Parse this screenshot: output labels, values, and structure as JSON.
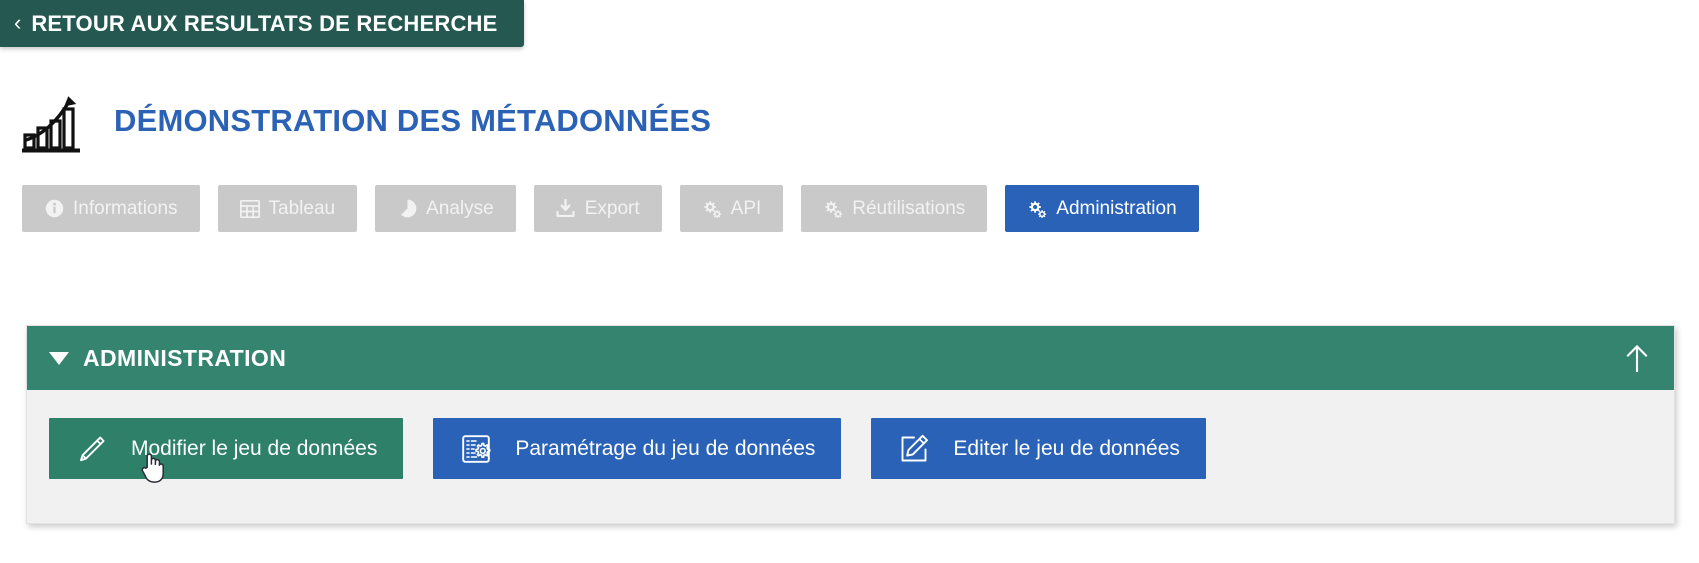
{
  "back": {
    "label": "RETOUR AUX RESULTATS DE RECHERCHE",
    "chevron": "‹",
    "icon_name": "chevron-left-icon",
    "bg_color": "#245851"
  },
  "header": {
    "title": "DÉMONSTRATION DES MÉTADONNÉES",
    "title_color": "#2b62b5",
    "icon_name": "bar-chart-growth-icon"
  },
  "tabs": [
    {
      "label": "Informations",
      "icon": "info-circle-icon",
      "active": false
    },
    {
      "label": "Tableau",
      "icon": "table-grid-icon",
      "active": false
    },
    {
      "label": "Analyse",
      "icon": "pie-chart-icon",
      "active": false
    },
    {
      "label": "Export",
      "icon": "download-tray-icon",
      "active": false
    },
    {
      "label": "API",
      "icon": "cogs-icon",
      "active": false
    },
    {
      "label": "Réutilisations",
      "icon": "cogs-icon",
      "active": false
    },
    {
      "label": "Administration",
      "icon": "cogs-icon",
      "active": true
    }
  ],
  "panel": {
    "title": "ADMINISTRATION",
    "header_bg": "#358470",
    "expanded": true,
    "caret_icon": "caret-down-icon",
    "collapse_icon": "arrow-up-icon",
    "actions": [
      {
        "label": "Modifier le jeu de données",
        "icon": "pencil-icon",
        "color": "#2e8069",
        "style": "green"
      },
      {
        "label": "Paramétrage du jeu de données",
        "icon": "settings-document-icon",
        "color": "#2a62b8",
        "style": "blue"
      },
      {
        "label": "Editer le jeu de données",
        "icon": "pencil-square-icon",
        "color": "#2a62b8",
        "style": "blue"
      }
    ]
  },
  "cursor": {
    "icon": "pointing-hand-cursor"
  }
}
